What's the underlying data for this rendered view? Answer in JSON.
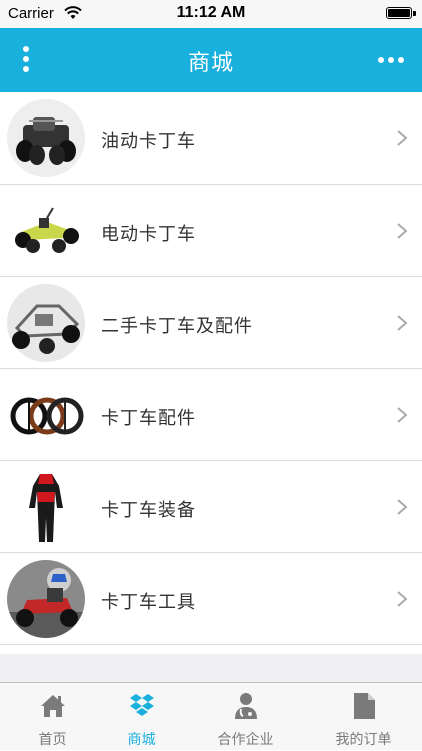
{
  "status_bar": {
    "carrier": "Carrier",
    "time": "11:12 AM"
  },
  "header": {
    "title": "商城"
  },
  "categories": [
    {
      "label": "油动卡丁车"
    },
    {
      "label": "电动卡丁车"
    },
    {
      "label": "二手卡丁车及配件"
    },
    {
      "label": "卡丁车配件"
    },
    {
      "label": "卡丁车装备"
    },
    {
      "label": "卡丁车工具"
    }
  ],
  "tabs": [
    {
      "label": "首页",
      "icon": "home-icon"
    },
    {
      "label": "商城",
      "icon": "dropbox-icon"
    },
    {
      "label": "合作企业",
      "icon": "doctor-icon"
    },
    {
      "label": "我的订单",
      "icon": "document-icon"
    }
  ],
  "colors": {
    "accent": "#1ab0dd",
    "tab_inactive": "#7a7a7a"
  }
}
